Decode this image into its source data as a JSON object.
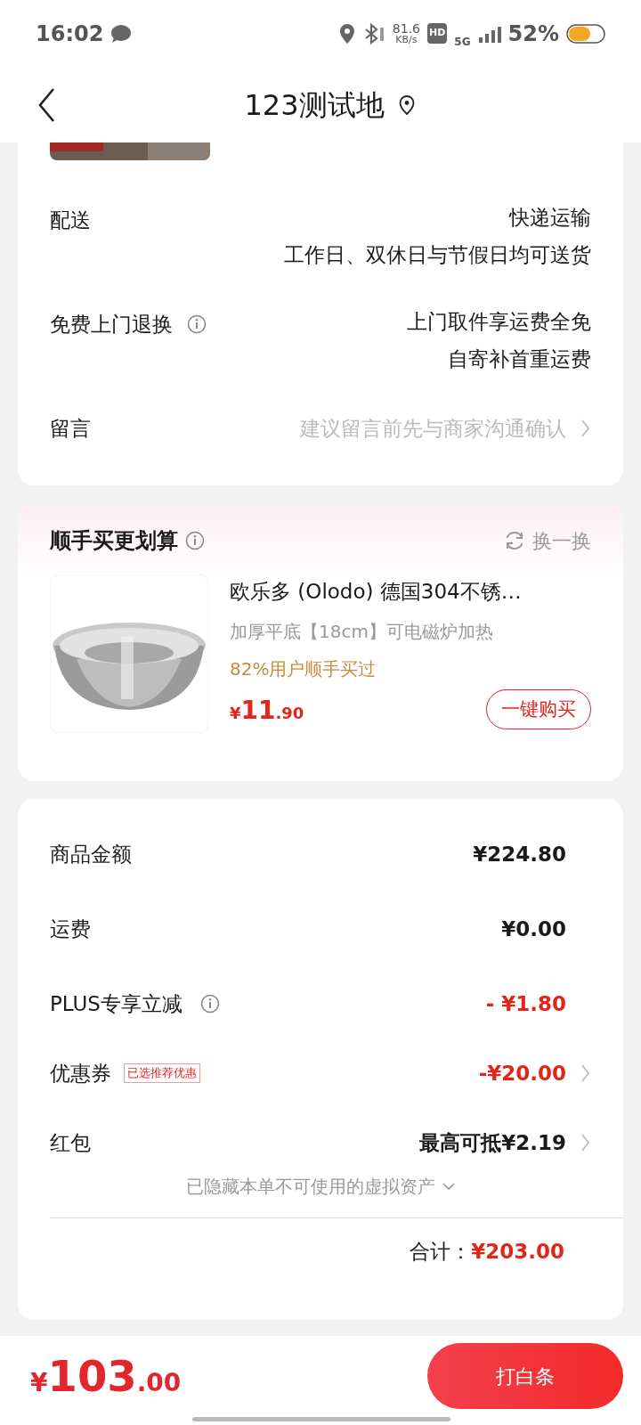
{
  "status_bar": {
    "time": "16:02",
    "speed": "81.6",
    "speed_unit": "KB/s",
    "hd": "HD",
    "network": "5G",
    "battery": "52%"
  },
  "header": {
    "title": "123测试地"
  },
  "delivery": [
    {
      "kind": "text",
      "label": "配送",
      "info": false,
      "values": [
        "快递运输",
        "工作日、双休日与节假日均可送货"
      ]
    },
    {
      "kind": "text",
      "label": "免费上门退换",
      "info": true,
      "values": [
        "上门取件享运费全免",
        "自寄补首重运费"
      ]
    },
    {
      "kind": "link",
      "label": "留言",
      "info": false,
      "values": [
        "建议留言前先与商家沟通确认"
      ]
    }
  ],
  "addon": {
    "title": "顺手买更划算",
    "action": "换一换",
    "product": {
      "kind": "picture",
      "name": "欧乐多 (Olodo) 德国304不锈…",
      "spec": "加厚平底【18cm】可电磁炉加热",
      "social_proof": "82%用户顺手买过",
      "currency": "¥",
      "price_int": "11",
      "price_dec": ".90",
      "button": "一键购买"
    }
  },
  "summary": {
    "rows": [
      {
        "label": "商品金额",
        "info": false,
        "value": "¥224.80",
        "discount": false,
        "chevron": false
      },
      {
        "label": "运费",
        "info": false,
        "value": "¥0.00",
        "discount": false,
        "chevron": false
      },
      {
        "label": "PLUS专享立减",
        "info": true,
        "value": "- ¥1.80",
        "discount": true,
        "chevron": false
      },
      {
        "label": "优惠券",
        "tag": "已选推荐优惠",
        "info": false,
        "value": "-¥20.00",
        "discount": true,
        "chevron": true
      },
      {
        "label": "红包",
        "info": false,
        "value": "最高可抵¥2.19",
        "discount": false,
        "chevron": true
      }
    ],
    "hidden_note": "已隐藏本单不可使用的虚拟资产",
    "total_label": "合计：",
    "total_value": "¥203.00"
  },
  "footer": {
    "currency": "¥",
    "price_int": "103",
    "price_dec": ".00",
    "button": "打白条"
  }
}
